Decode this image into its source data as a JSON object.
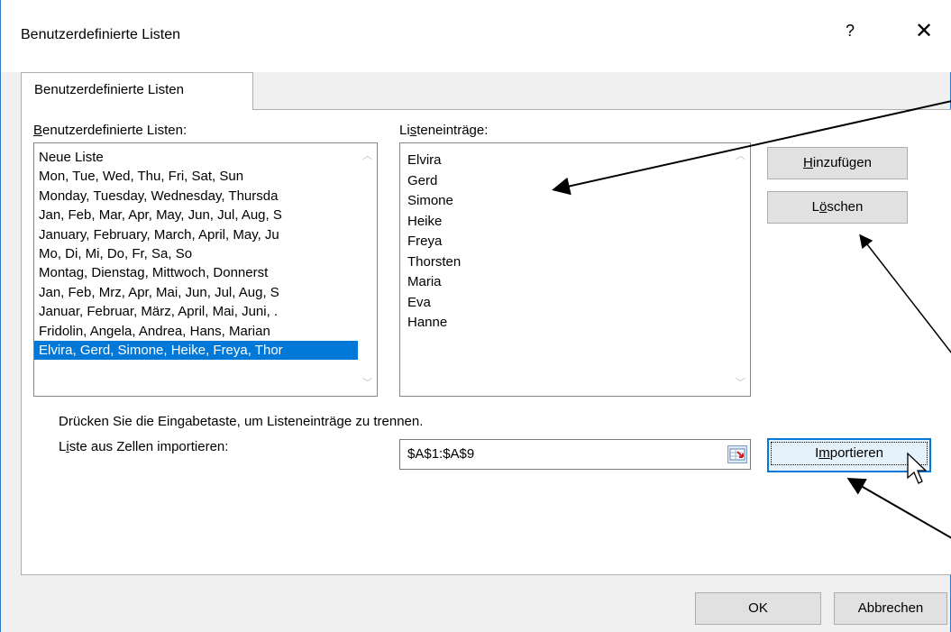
{
  "window": {
    "title": "Benutzerdefinierte Listen",
    "help_glyph": "?",
    "close_glyph": "✕"
  },
  "tab": {
    "label": "Benutzerdefinierte Listen"
  },
  "custom_lists": {
    "label_accel": "B",
    "label_rest": "enutzerdefinierte Listen:",
    "items": [
      "Neue Liste",
      "Mon, Tue, Wed, Thu, Fri, Sat, Sun",
      "Monday, Tuesday, Wednesday, Thursda",
      "Jan, Feb, Mar, Apr, May, Jun, Jul, Aug, S",
      "January, February, March, April, May, Ju",
      "Mo, Di, Mi, Do, Fr, Sa, So",
      "Montag, Dienstag, Mittwoch, Donnerst",
      "Jan, Feb, Mrz, Apr, Mai, Jun, Jul, Aug, S",
      "Januar, Februar, März, April, Mai, Juni, .",
      "Fridolin, Angela, Andrea, Hans, Marian",
      "Elvira, Gerd, Simone, Heike, Freya, Thor"
    ],
    "selected_index": 10
  },
  "list_entries": {
    "label_pre": "Li",
    "label_accel": "s",
    "label_rest": "teneinträge:",
    "items": [
      "Elvira",
      "Gerd",
      "Simone",
      "Heike",
      "Freya",
      "Thorsten",
      "Maria",
      "Eva",
      "Hanne"
    ]
  },
  "buttons": {
    "add_accel": "H",
    "add_rest": "inzufügen",
    "delete_pre": "L",
    "delete_accel": "ö",
    "delete_rest": "schen",
    "import_pre": "I",
    "import_accel": "m",
    "import_rest": "portieren",
    "ok": "OK",
    "cancel": "Abbrechen"
  },
  "hint": "Drücken Sie die Eingabetaste, um Listeneinträge zu trennen.",
  "import": {
    "label_pre": "L",
    "label_accel": "i",
    "label_rest": "ste aus Zellen importieren:",
    "value": "$A$1:$A$9"
  },
  "colors": {
    "selection": "#0078d7",
    "window_border": "#2b78c5",
    "annotation": "#000000"
  }
}
